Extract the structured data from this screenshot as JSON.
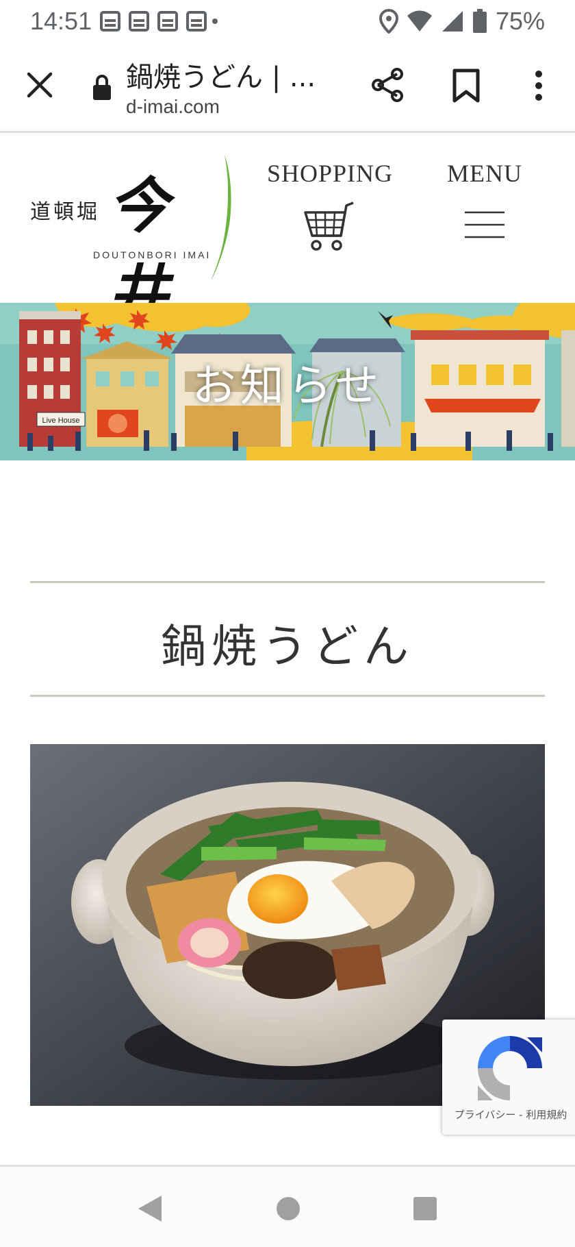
{
  "status_bar": {
    "time": "14:51",
    "battery": "75%",
    "icons": [
      "notification-icon",
      "notification-icon",
      "notification-icon",
      "notification-icon",
      "location-icon",
      "wifi-icon",
      "signal-icon",
      "battery-icon"
    ]
  },
  "tab_bar": {
    "title": "鍋焼うどん | ...",
    "url": "d-imai.com",
    "icons": [
      "close-icon",
      "lock-icon",
      "share-icon",
      "bookmark-icon",
      "more-vert-icon"
    ]
  },
  "header": {
    "logo_small": "道頓堀",
    "logo_big": "今井",
    "logo_roman": "DOUTONBORI IMAI",
    "shopping_label": "SHOPPING",
    "menu_label": "MENU"
  },
  "banner": {
    "title": "お知らせ",
    "sign_text": "Live House"
  },
  "article": {
    "title": "鍋焼うどん"
  },
  "recaptcha": {
    "links": "プライバシー - 利用規約"
  },
  "colors": {
    "accent_green": "#6cb33f",
    "banner_teal": "#7fc4bd",
    "banner_gold": "#f2c230",
    "rule": "#c9c9bd"
  }
}
